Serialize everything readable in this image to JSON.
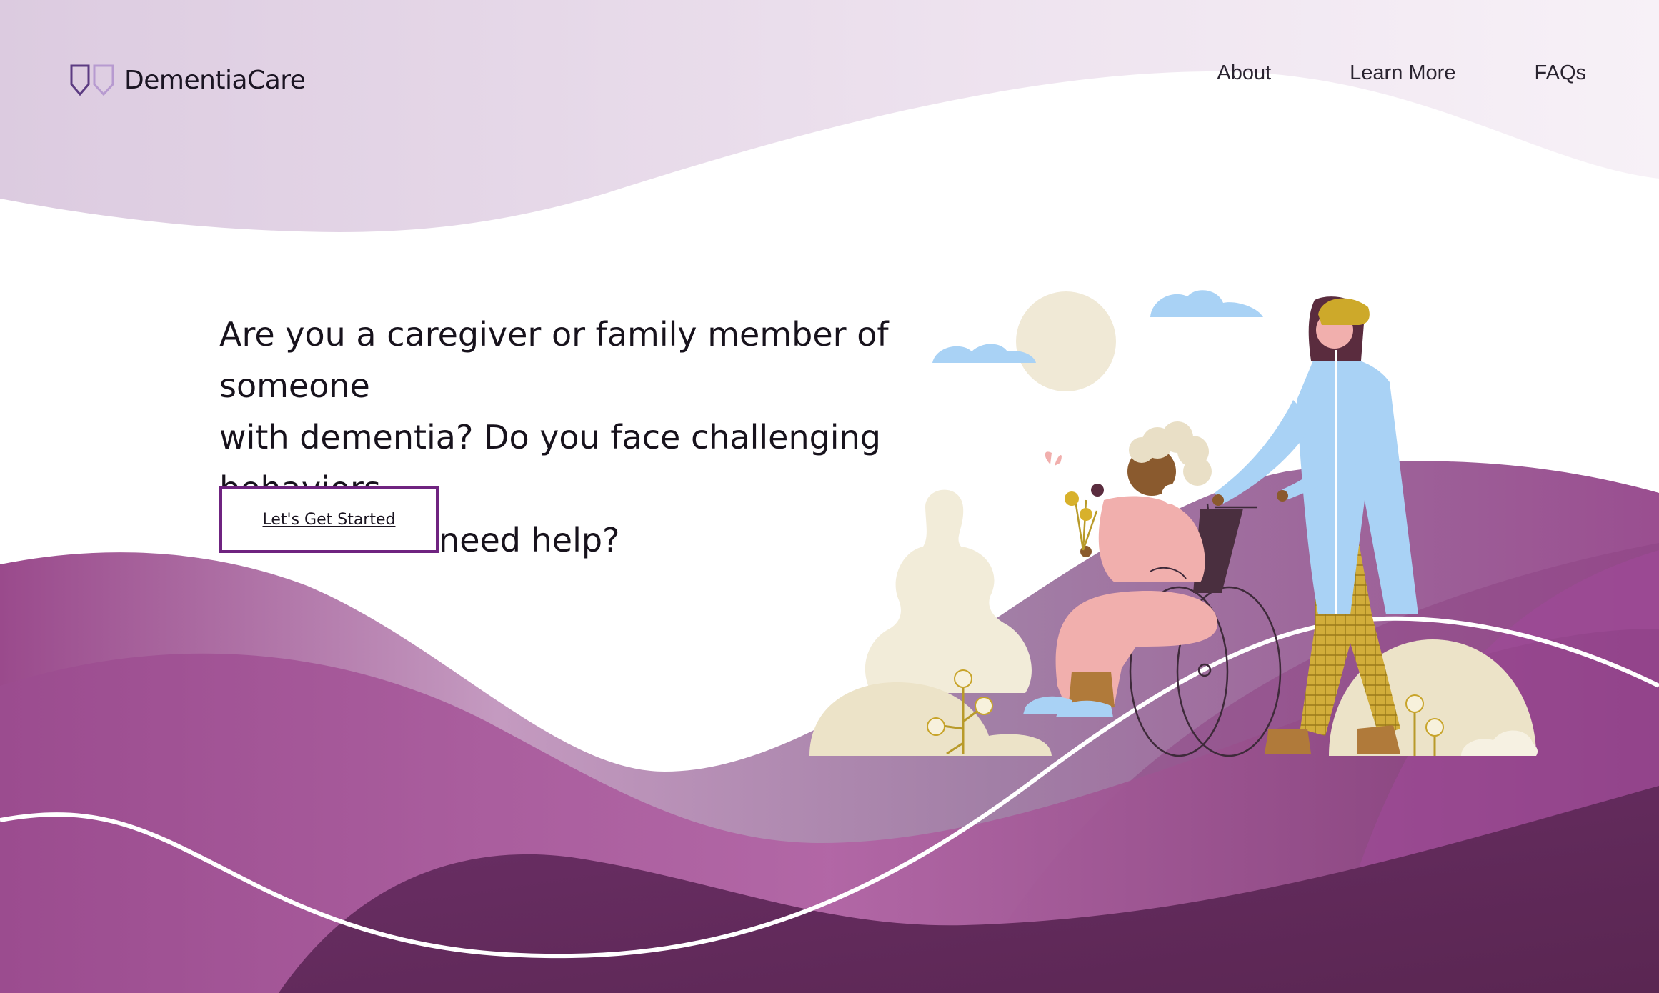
{
  "brand": {
    "name": "DementiaCare",
    "logo_icon": "double-shield-outline-icon"
  },
  "nav": {
    "about": "About",
    "learn_more": "Learn More",
    "faqs": "FAQs"
  },
  "hero": {
    "heading_line1": "Are you a caregiver or family member of someone",
    "heading_line2": "with dementia? Do you face challenging behaviors",
    "heading_line3": "at home and need help?",
    "cta_label": "Let's Get Started"
  },
  "colors": {
    "brand_purple": "#6f2380",
    "hill_dark": "#5f2a5a",
    "hill_mid": "#a0518f",
    "hill_light": "#bf86b4",
    "header_wash": "#e5d6e8",
    "cream": "#ece3c8",
    "sky_blue": "#a9d2f5",
    "mustard": "#cda92a",
    "pink": "#f1afad"
  }
}
